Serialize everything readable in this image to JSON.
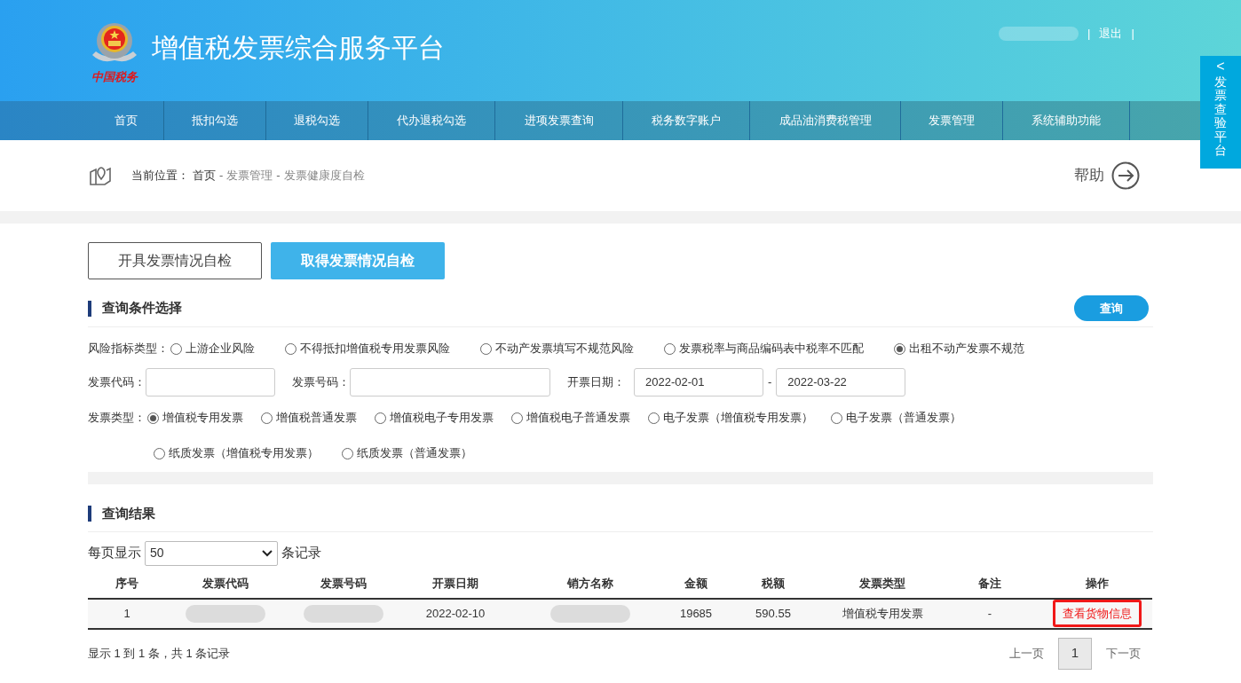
{
  "header": {
    "logo_text": "中国税务",
    "title": "增值税发票综合服务平台",
    "user": {
      "kind": "redacted"
    },
    "logout": "退出",
    "separators": [
      "|",
      "|"
    ]
  },
  "nav": [
    {
      "label": "首页",
      "selected": false
    },
    {
      "label": "抵扣勾选",
      "selected": false
    },
    {
      "label": "退税勾选",
      "selected": false
    },
    {
      "label": "代办退税勾选",
      "selected": false
    },
    {
      "label": "进项发票查询",
      "selected": false
    },
    {
      "label": "税务数字账户",
      "selected": false
    },
    {
      "label": "成品油消费税管理",
      "selected": false
    },
    {
      "label": "发票管理",
      "selected": false
    },
    {
      "label": "系统辅助功能",
      "selected": false
    }
  ],
  "side_tab": {
    "arrow": "<",
    "label": "发票查验平台"
  },
  "breadcrumb": {
    "prefix": "当前位置：",
    "items": [
      "首页",
      "发票管理",
      "发票健康度自检"
    ],
    "separator": "-"
  },
  "help": "帮助",
  "tabs": [
    {
      "label": "开具发票情况自检",
      "selected": false
    },
    {
      "label": "取得发票情况自检",
      "selected": true
    }
  ],
  "query_section": {
    "title": "查询条件选择",
    "query_button": "查询",
    "risk_type": {
      "label": "风险指标类型：",
      "options": [
        {
          "label": "上游企业风险",
          "selected": false
        },
        {
          "label": "不得抵扣增值税专用发票风险",
          "selected": false
        },
        {
          "label": "不动产发票填写不规范风险",
          "selected": false
        },
        {
          "label": "发票税率与商品编码表中税率不匹配",
          "selected": false
        },
        {
          "label": "出租不动产发票不规范",
          "selected": true
        }
      ]
    },
    "invoice_code": {
      "label": "发票代码："
    },
    "invoice_number": {
      "label": "发票号码："
    },
    "date": {
      "label": "开票日期：",
      "from": "2022-02-01",
      "separator": "-",
      "to": "2022-03-22"
    },
    "invoice_type": {
      "label": "发票类型：",
      "options": [
        {
          "label": "增值税专用发票",
          "selected": true
        },
        {
          "label": "增值税普通发票",
          "selected": false
        },
        {
          "label": "增值税电子专用发票",
          "selected": false
        },
        {
          "label": "增值税电子普通发票",
          "selected": false
        },
        {
          "label": "电子发票（增值税专用发票）",
          "selected": false
        },
        {
          "label": "电子发票（普通发票）",
          "selected": false
        },
        {
          "label": "纸质发票（增值税专用发票）",
          "selected": false
        },
        {
          "label": "纸质发票（普通发票）",
          "selected": false
        }
      ]
    }
  },
  "results": {
    "title": "查询结果",
    "page_size": {
      "prefix": "每页显示",
      "value": "50",
      "suffix": "条记录"
    },
    "columns": [
      "序号",
      "发票代码",
      "发票号码",
      "开票日期",
      "销方名称",
      "金额",
      "税额",
      "发票类型",
      "备注",
      "操作"
    ],
    "rows": [
      {
        "cells": [
          {
            "kind": "text",
            "text": "1"
          },
          {
            "kind": "redacted"
          },
          {
            "kind": "redacted"
          },
          {
            "kind": "text",
            "text": "2022-02-10"
          },
          {
            "kind": "redacted"
          },
          {
            "kind": "text",
            "text": "19685"
          },
          {
            "kind": "text",
            "text": "590.55"
          },
          {
            "kind": "text",
            "text": "增值税专用发票"
          },
          {
            "kind": "text",
            "text": "-"
          },
          {
            "kind": "action",
            "text": "查看货物信息",
            "highlighted": true
          }
        ]
      }
    ],
    "summary": "显示 1 到 1 条，共 1 条记录",
    "pagination": {
      "prev": "上一页",
      "pages": [
        {
          "label": "1",
          "selected": true
        }
      ],
      "next": "下一页"
    }
  }
}
